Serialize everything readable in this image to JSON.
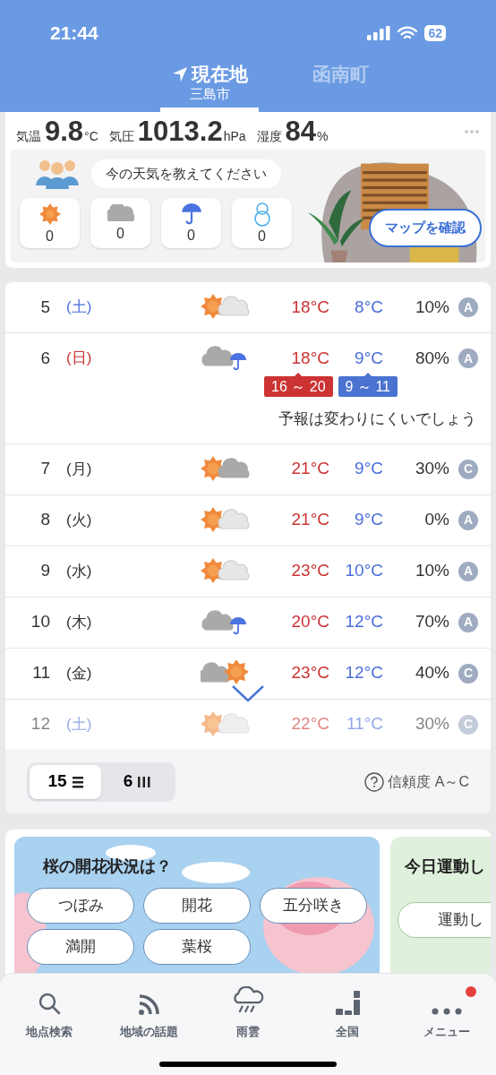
{
  "status_bar": {
    "time": "21:44",
    "battery": "62"
  },
  "location_tabs": [
    {
      "label": "現在地",
      "sublabel": "三島市",
      "selected": true,
      "gps": true
    },
    {
      "label": "函南町",
      "selected": false,
      "gps": false
    }
  ],
  "current": {
    "stats": [
      {
        "label": "気温",
        "value": "9.8",
        "unit": "°C"
      },
      {
        "label": "気圧",
        "value": "1013.2",
        "unit": "hPa"
      },
      {
        "label": "湿度",
        "value": "84",
        "unit": "%"
      }
    ],
    "prompt": "今の天気を教えてください",
    "reports": [
      {
        "kind": "sun",
        "count": "0"
      },
      {
        "kind": "cloud",
        "count": "0"
      },
      {
        "kind": "rain",
        "count": "0"
      },
      {
        "kind": "snow",
        "count": "0"
      }
    ],
    "map_button": "マップを確認"
  },
  "forecast": {
    "rows": [
      {
        "day": "5",
        "weekday": {
          "text": "(土)",
          "kind": "saturday"
        },
        "weather": {
          "kind": "sun_cloud"
        },
        "high": "18°C",
        "low": "8°C",
        "pop": "10%",
        "reliability": "A",
        "faded": false
      },
      {
        "day": "6",
        "weekday": {
          "text": "(日)",
          "kind": "sunday"
        },
        "weather": {
          "kind": "cloud_rain"
        },
        "high": "18°C",
        "low": "9°C",
        "pop": "80%",
        "reliability": "A",
        "faded": false,
        "high_range": "16 ～ 20",
        "low_range": "9 ～ 11",
        "note": "予報は変わりにくいでしょう"
      },
      {
        "day": "7",
        "weekday": {
          "text": "(月)",
          "kind": "weekday"
        },
        "weather": {
          "kind": "sun_graycloud"
        },
        "high": "21°C",
        "low": "9°C",
        "pop": "30%",
        "reliability": "C",
        "faded": false
      },
      {
        "day": "8",
        "weekday": {
          "text": "(火)",
          "kind": "weekday"
        },
        "weather": {
          "kind": "sun_cloud"
        },
        "high": "21°C",
        "low": "9°C",
        "pop": "0%",
        "reliability": "A",
        "faded": false
      },
      {
        "day": "9",
        "weekday": {
          "text": "(水)",
          "kind": "weekday"
        },
        "weather": {
          "kind": "sun_cloud"
        },
        "high": "23°C",
        "low": "10°C",
        "pop": "10%",
        "reliability": "A",
        "faded": false
      },
      {
        "day": "10",
        "weekday": {
          "text": "(木)",
          "kind": "weekday"
        },
        "weather": {
          "kind": "cloud_rain"
        },
        "high": "20°C",
        "low": "12°C",
        "pop": "70%",
        "reliability": "A",
        "faded": false
      },
      {
        "day": "11",
        "weekday": {
          "text": "(金)",
          "kind": "weekday"
        },
        "weather": {
          "kind": "cloud_sun"
        },
        "high": "23°C",
        "low": "12°C",
        "pop": "40%",
        "reliability": "C",
        "faded": false
      },
      {
        "day": "12",
        "weekday": {
          "text": "(土)",
          "kind": "saturday"
        },
        "weather": {
          "kind": "sun_cloud"
        },
        "high": "22°C",
        "low": "11°C",
        "pop": "30%",
        "reliability": "C",
        "faded": true
      }
    ],
    "view_toggle": [
      {
        "label": "15",
        "kind": "list",
        "selected": true
      },
      {
        "label": "6",
        "kind": "columns",
        "selected": false
      }
    ],
    "reliability_help": "信頼度 A～C"
  },
  "cards": [
    {
      "kind": "sakura",
      "title": "桜の開花状況は？",
      "options": [
        "つぼみ",
        "開花",
        "五分咲き",
        "満開",
        "葉桜"
      ]
    },
    {
      "kind": "exercise",
      "title": "今日運動し",
      "options": [
        "運動し"
      ]
    }
  ],
  "tab_bar": [
    {
      "label": "地点検索",
      "kind": "search",
      "badge": false
    },
    {
      "label": "地域の話題",
      "kind": "feed",
      "badge": false
    },
    {
      "label": "雨雲",
      "kind": "raincloud",
      "badge": false
    },
    {
      "label": "全国",
      "kind": "stairs",
      "badge": false
    },
    {
      "label": "メニュー",
      "kind": "dots",
      "badge": true
    }
  ]
}
